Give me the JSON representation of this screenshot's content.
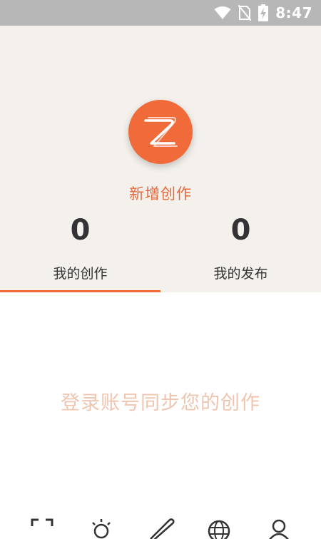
{
  "status": {
    "time": "8:47",
    "icons": [
      "wifi-icon",
      "no-sim-icon",
      "battery-charging-icon"
    ]
  },
  "create": {
    "label": "新增创作",
    "icon": "z-logo-icon",
    "accent_color": "#f06a3a"
  },
  "stats": [
    {
      "count": "0",
      "label": "我的创作",
      "active": true
    },
    {
      "count": "0",
      "label": "我的发布",
      "active": false
    }
  ],
  "empty_message": "登录账号同步您的创作",
  "bottom_nav": [
    "scan-icon",
    "lightbulb-icon",
    "pen-icon",
    "globe-icon",
    "profile-icon"
  ]
}
